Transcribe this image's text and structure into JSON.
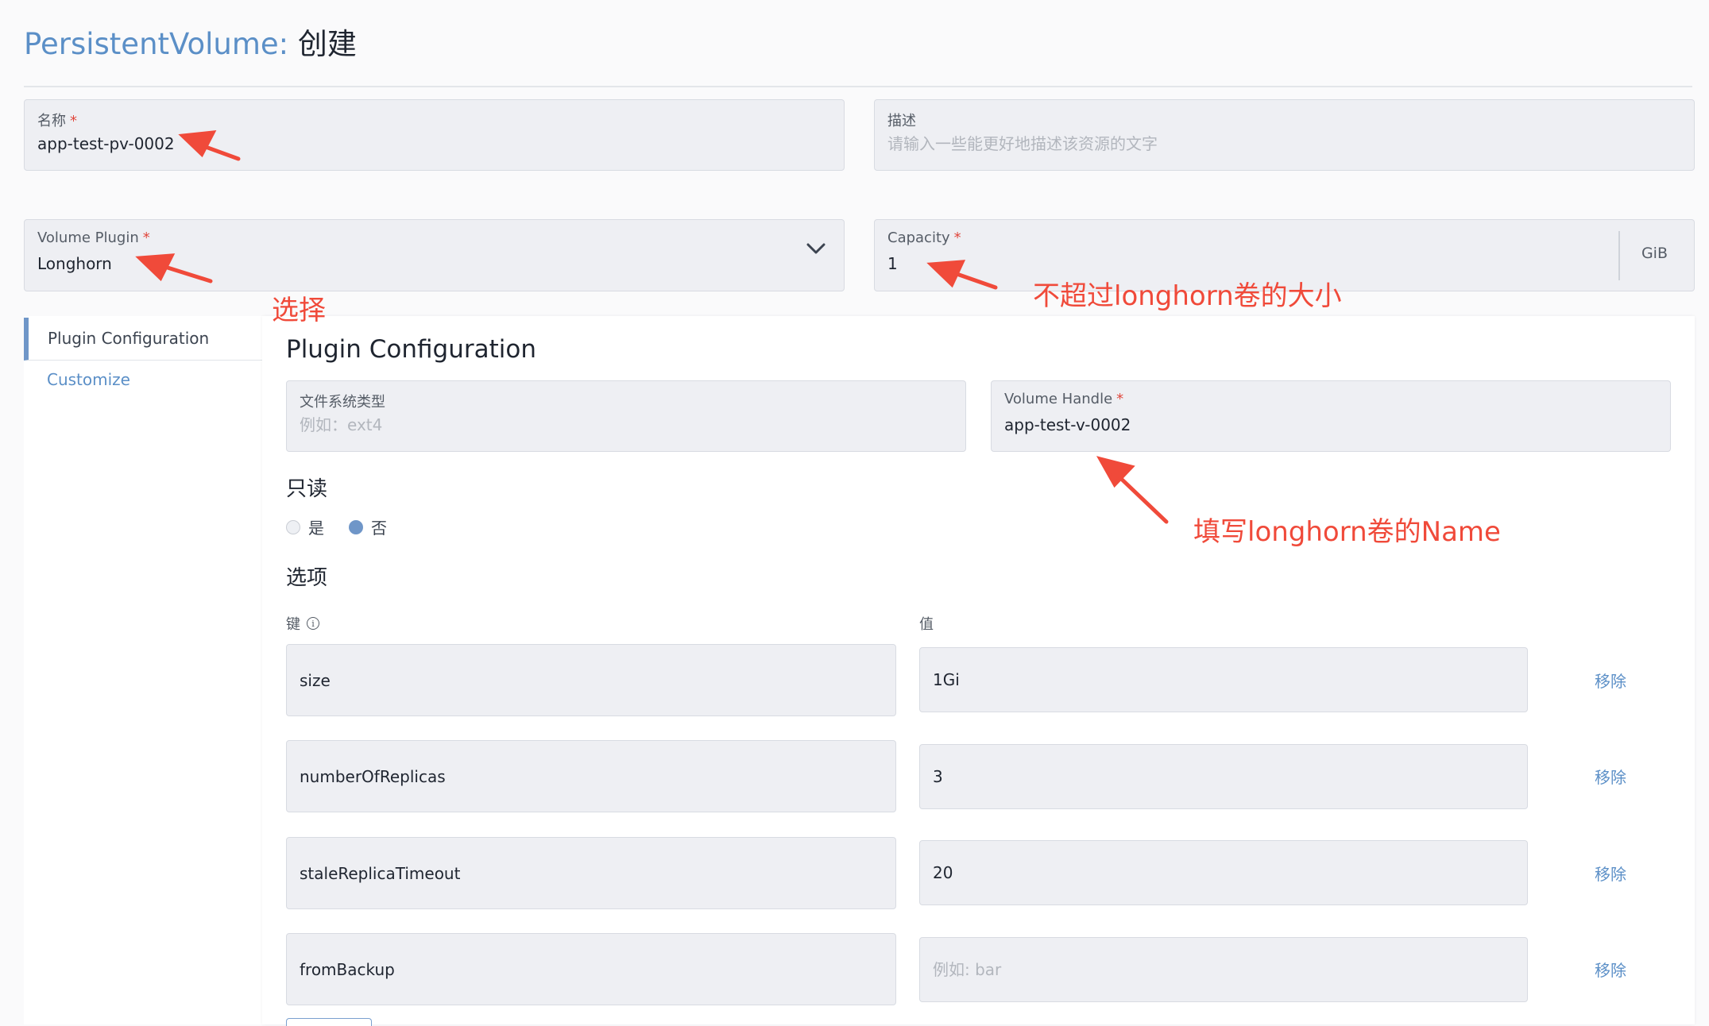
{
  "header": {
    "resource": "PersistentVolume:",
    "action": "创建"
  },
  "form": {
    "name": {
      "label": "名称",
      "required_mark": "*",
      "value": "app-test-pv-0002"
    },
    "description": {
      "label": "描述",
      "placeholder": "请输入一些能更好地描述该资源的文字"
    },
    "volume_plugin": {
      "label": "Volume Plugin",
      "required_mark": "*",
      "value": "Longhorn"
    },
    "capacity": {
      "label": "Capacity",
      "required_mark": "*",
      "value": "1",
      "unit": "GiB"
    }
  },
  "sidebar": {
    "tabs": [
      {
        "label": "Plugin Configuration",
        "active": true
      },
      {
        "label": "Customize",
        "active": false
      }
    ]
  },
  "plugin_config": {
    "title": "Plugin Configuration",
    "fs_type": {
      "label": "文件系统类型",
      "placeholder": "例如：ext4"
    },
    "volume_handle": {
      "label": "Volume Handle",
      "required_mark": "*",
      "value": "app-test-v-0002"
    },
    "readonly": {
      "title": "只读",
      "options": [
        {
          "label": "是",
          "selected": false
        },
        {
          "label": "否",
          "selected": true
        }
      ]
    },
    "options": {
      "title": "选项",
      "key_header": "键",
      "value_header": "值",
      "remove_label": "移除",
      "rows": [
        {
          "key": "size",
          "value": "1Gi",
          "value_placeholder": ""
        },
        {
          "key": "numberOfReplicas",
          "value": "3",
          "value_placeholder": ""
        },
        {
          "key": "staleReplicaTimeout",
          "value": "20",
          "value_placeholder": ""
        },
        {
          "key": "fromBackup",
          "value": "",
          "value_placeholder": "例如: bar"
        }
      ]
    }
  },
  "annotations": {
    "select": "选择",
    "capacity_note": "不超过longhorn卷的大小",
    "handle_note": "填写longhorn卷的Name"
  },
  "colors": {
    "accent": "#5b8fc7",
    "annotation": "#f04a3a",
    "required": "#e0473c",
    "field_bg": "#eeeff3"
  },
  "icons": {
    "dropdown": "chevron-down-icon",
    "info": "info-icon",
    "annotation_arrow": "arrow-icon"
  }
}
